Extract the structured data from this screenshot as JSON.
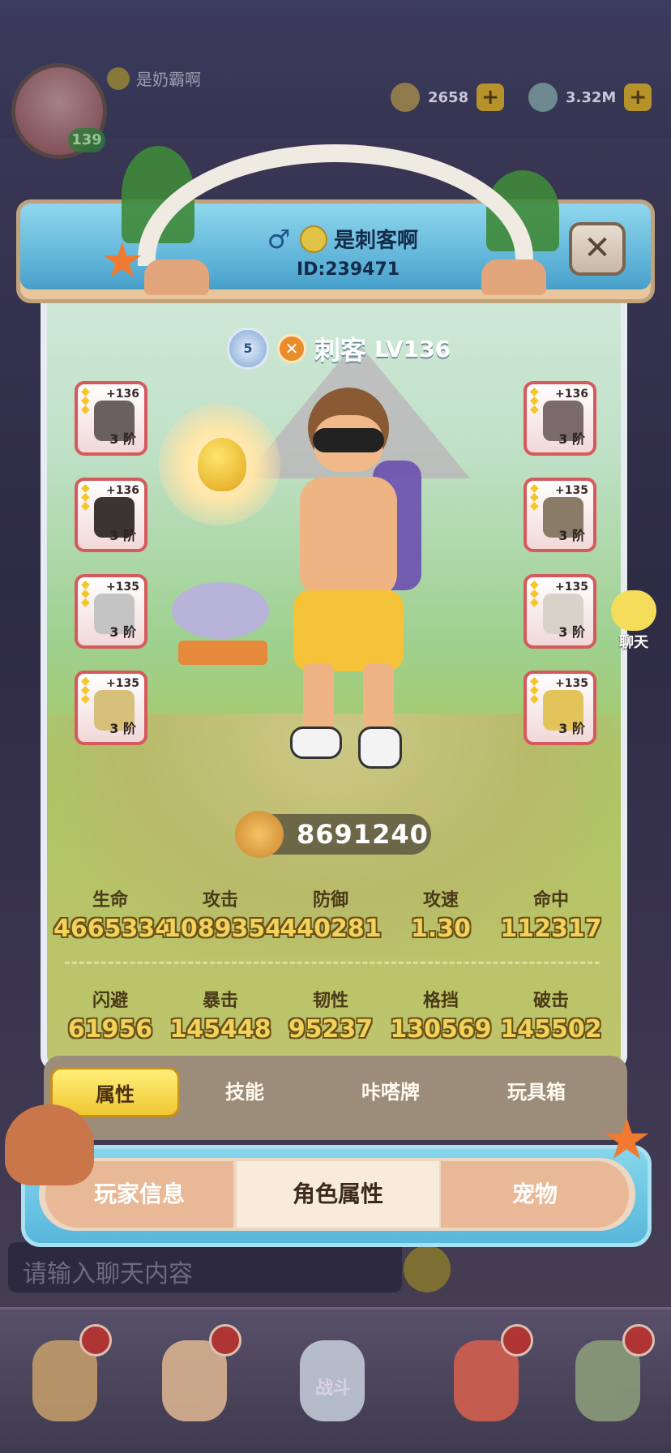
{
  "top_bar": {
    "player_name": "是奶霸啊",
    "player_level": "139",
    "currency1": "2658",
    "currency2": "3.32M"
  },
  "panel": {
    "title_name": "是刺客啊",
    "title_id": "ID:239471",
    "rank_badge": "5",
    "class_name": "刺客",
    "class_level": "LV136",
    "power": "8691240"
  },
  "equipment_left": [
    {
      "plus": "+136",
      "tier": "3 阶",
      "color": "#6a6060"
    },
    {
      "plus": "+136",
      "tier": "3 阶",
      "color": "#3b3434"
    },
    {
      "plus": "+135",
      "tier": "3 阶",
      "color": "#c4c4c4"
    },
    {
      "plus": "+135",
      "tier": "3 阶",
      "color": "#d6c07a"
    }
  ],
  "equipment_right": [
    {
      "plus": "+136",
      "tier": "3 阶",
      "color": "#7a6a6a"
    },
    {
      "plus": "+135",
      "tier": "3 阶",
      "color": "#8a7b66"
    },
    {
      "plus": "+135",
      "tier": "3 阶",
      "color": "#d8d2c8"
    },
    {
      "plus": "+135",
      "tier": "3 阶",
      "color": "#e2c45a"
    }
  ],
  "stats_row1": [
    {
      "label": "生命",
      "value": "4665334"
    },
    {
      "label": "攻击",
      "value": "1089354"
    },
    {
      "label": "防御",
      "value": "440281"
    },
    {
      "label": "攻速",
      "value": "1.30"
    },
    {
      "label": "命中",
      "value": "112317"
    }
  ],
  "stats_row2": [
    {
      "label": "闪避",
      "value": "61956"
    },
    {
      "label": "暴击",
      "value": "145448"
    },
    {
      "label": "韧性",
      "value": "95237"
    },
    {
      "label": "格挡",
      "value": "130569"
    },
    {
      "label": "破击",
      "value": "145502"
    }
  ],
  "tabs": [
    "属性",
    "技能",
    "咔嗒牌",
    "玩具箱"
  ],
  "bottom_tabs": [
    "玩家信息",
    "角色属性",
    "宠物"
  ],
  "chat": {
    "float_label": "聊天",
    "input_placeholder": "请输入聊天内容"
  },
  "nav": {
    "battle_label": "战斗"
  }
}
